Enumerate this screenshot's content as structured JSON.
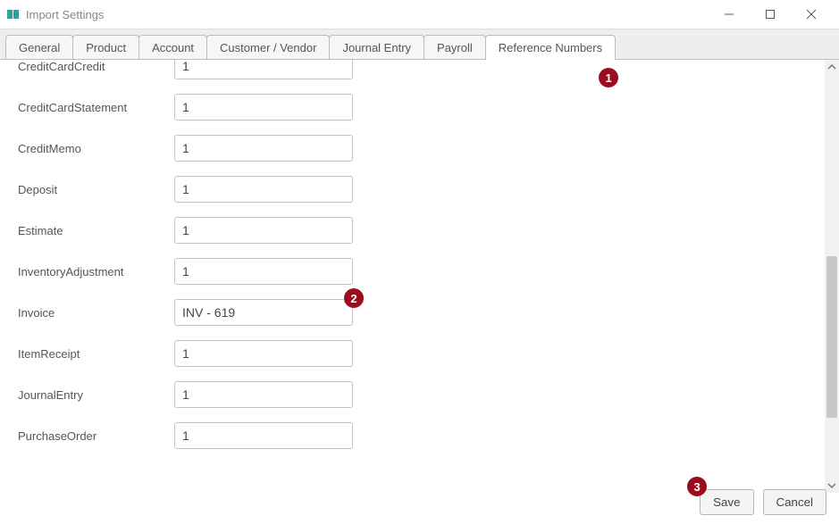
{
  "window": {
    "title": "Import Settings"
  },
  "tabs": [
    {
      "label": "General"
    },
    {
      "label": "Product"
    },
    {
      "label": "Account"
    },
    {
      "label": "Customer / Vendor"
    },
    {
      "label": "Journal Entry"
    },
    {
      "label": "Payroll"
    },
    {
      "label": "Reference Numbers",
      "active": true
    }
  ],
  "fields": {
    "creditCardCredit": {
      "label": "CreditCardCredit",
      "value": "1"
    },
    "creditCardStatement": {
      "label": "CreditCardStatement",
      "value": "1"
    },
    "creditMemo": {
      "label": "CreditMemo",
      "value": "1"
    },
    "deposit": {
      "label": "Deposit",
      "value": "1"
    },
    "estimate": {
      "label": "Estimate",
      "value": "1"
    },
    "inventoryAdjustment": {
      "label": "InventoryAdjustment",
      "value": "1"
    },
    "invoice": {
      "label": "Invoice",
      "value": "INV - 619"
    },
    "itemReceipt": {
      "label": "ItemReceipt",
      "value": "1"
    },
    "journalEntry": {
      "label": "JournalEntry",
      "value": "1"
    },
    "purchaseOrder": {
      "label": "PurchaseOrder",
      "value": "1"
    }
  },
  "badges": {
    "b1": "1",
    "b2": "2",
    "b3": "3"
  },
  "buttons": {
    "save": "Save",
    "cancel": "Cancel"
  }
}
